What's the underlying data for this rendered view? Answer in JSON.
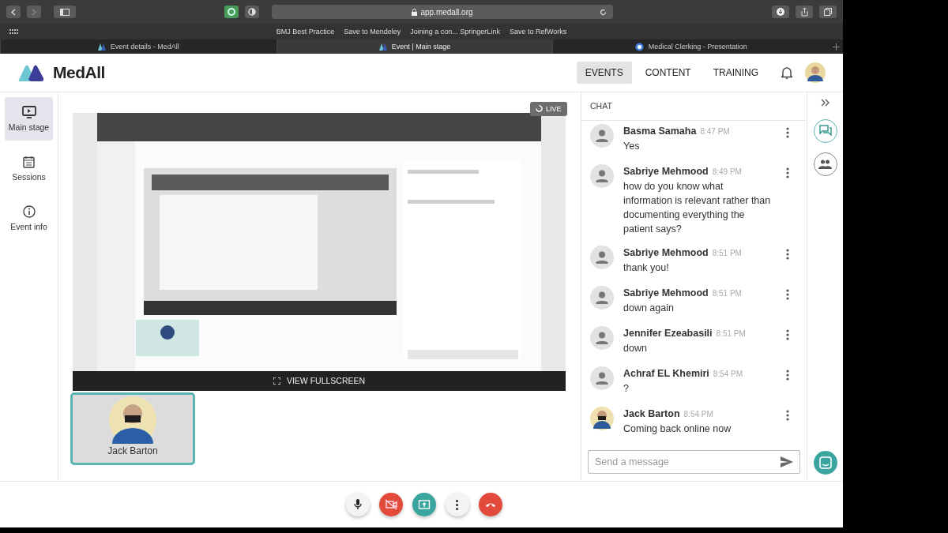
{
  "browser": {
    "url": "app.medall.org",
    "bookmarks": [
      "BMJ Best Practice",
      "Save to Mendeley",
      "Joining a con... SpringerLink",
      "Save to RefWorks"
    ],
    "tabs": [
      {
        "title": "Event details - MedAll",
        "selected": false,
        "kind": "medall"
      },
      {
        "title": "Event | Main stage",
        "selected": true,
        "kind": "medall"
      },
      {
        "title": "Medical Clerking - Presentation",
        "selected": false,
        "kind": "presentation"
      }
    ]
  },
  "header": {
    "brand": "MedAll",
    "nav": [
      {
        "label": "EVENTS",
        "selected": true
      },
      {
        "label": "CONTENT",
        "selected": false
      },
      {
        "label": "TRAINING",
        "selected": false
      }
    ]
  },
  "sidebar": {
    "items": [
      {
        "label": "Main stage",
        "selected": true,
        "kind": "stage"
      },
      {
        "label": "Sessions",
        "selected": false,
        "kind": "sessions"
      },
      {
        "label": "Event info",
        "selected": false,
        "kind": "info"
      }
    ]
  },
  "stage": {
    "live_badge": "LIVE",
    "fullscreen": "VIEW FULLSCREEN",
    "participant": {
      "name": "Jack Barton"
    }
  },
  "chat": {
    "title": "CHAT",
    "placeholder": "Send a message",
    "messages": [
      {
        "name": "Basma Samaha",
        "time": "8:47 PM",
        "text": "Yes",
        "kind": "placeholder"
      },
      {
        "name": "Sabriye Mehmood",
        "time": "8:49 PM",
        "text": "how do you know what information is relevant rather than documenting everything the patient says?",
        "kind": "placeholder"
      },
      {
        "name": "Sabriye Mehmood",
        "time": "8:51 PM",
        "text": "thank you!",
        "kind": "placeholder"
      },
      {
        "name": "Sabriye Mehmood",
        "time": "8:51 PM",
        "text": "down again",
        "kind": "placeholder"
      },
      {
        "name": "Jennifer Ezeabasili",
        "time": "8:51 PM",
        "text": "down",
        "kind": "placeholder"
      },
      {
        "name": "Achraf EL Khemiri",
        "time": "8:54 PM",
        "text": "?",
        "kind": "placeholder"
      },
      {
        "name": "Jack Barton",
        "time": "8:54 PM",
        "text": "Coming back online now"
      }
    ]
  },
  "rail": {
    "items": [
      {
        "kind": "chat",
        "selected": true
      },
      {
        "kind": "people",
        "selected": false
      }
    ]
  },
  "controls": [
    {
      "kind": "mic"
    },
    {
      "kind": "camera-off"
    },
    {
      "kind": "share"
    },
    {
      "kind": "more"
    },
    {
      "kind": "hangup"
    }
  ]
}
